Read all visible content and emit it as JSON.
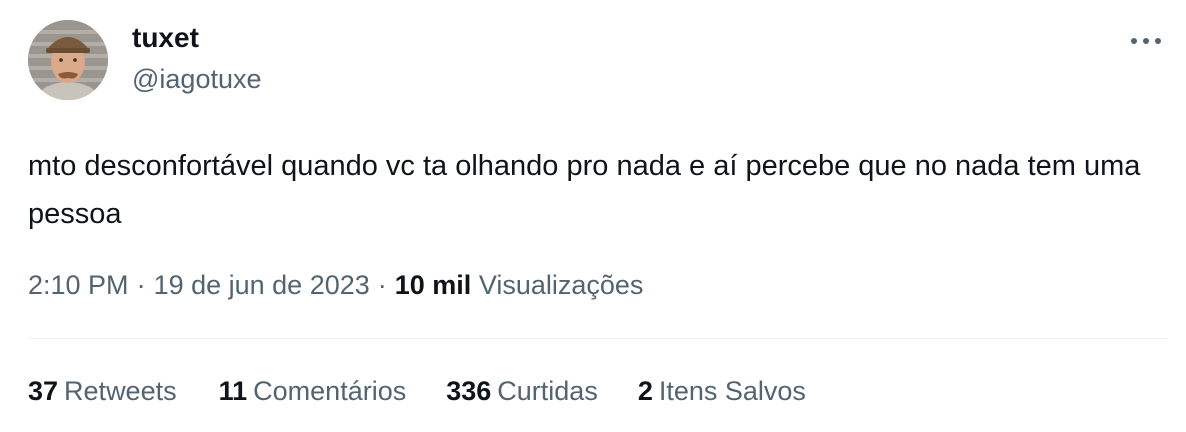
{
  "author": {
    "display_name": "tuxet",
    "handle": "@iagotuxe"
  },
  "tweet": {
    "text": "mto desconfortável quando vc ta olhando pro nada e aí percebe que no nada tem uma pessoa"
  },
  "meta": {
    "time": "2:10 PM",
    "separator": "·",
    "date": "19 de jun de 2023",
    "views_count": "10 mil",
    "views_label": "Visualizações"
  },
  "stats": {
    "retweets": {
      "count": "37",
      "label": "Retweets"
    },
    "comments": {
      "count": "11",
      "label": "Comentários"
    },
    "likes": {
      "count": "336",
      "label": "Curtidas"
    },
    "saves": {
      "count": "2",
      "label": "Itens Salvos"
    }
  },
  "icons": {
    "more": "more-horizontal-icon"
  },
  "colors": {
    "text_primary": "#0f1419",
    "text_secondary": "#536471",
    "divider": "#eff3f4"
  }
}
